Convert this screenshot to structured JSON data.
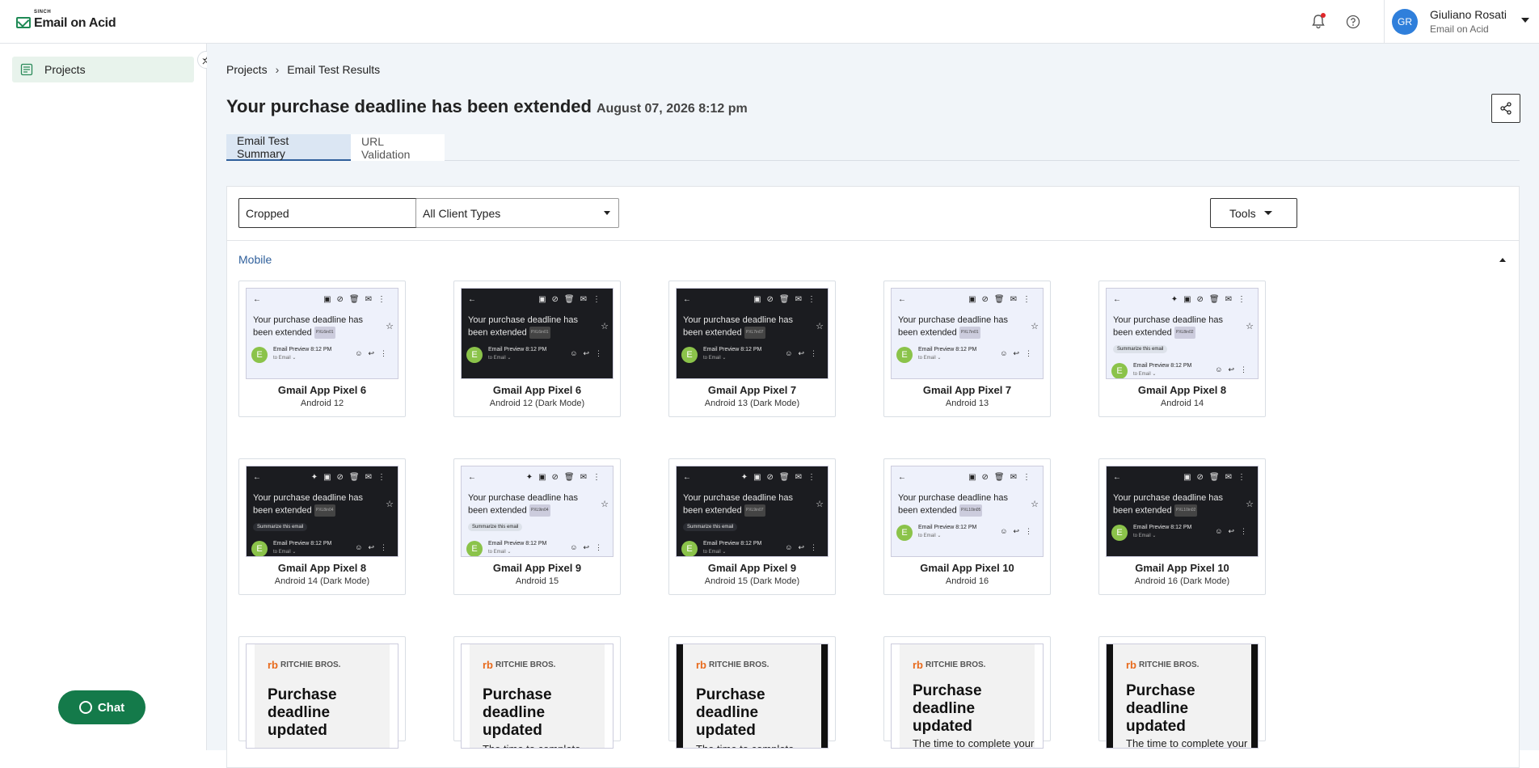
{
  "app": {
    "sinch": "SINCH",
    "brand": "Email on Acid"
  },
  "user": {
    "initials": "GR",
    "name": "Giuliano Rosati",
    "org": "Email on Acid"
  },
  "sidebar": {
    "items": [
      {
        "label": "Projects"
      }
    ]
  },
  "breadcrumb": {
    "parent": "Projects",
    "current": "Email Test Results"
  },
  "page": {
    "title": "Your purchase deadline has been extended",
    "date": "August 07, 2026 8:12 pm"
  },
  "tabs": [
    {
      "label": "Email Test Summary",
      "active": true
    },
    {
      "label": "URL Validation",
      "active": false
    }
  ],
  "filters": {
    "view": "Cropped",
    "client_types": "All Client Types",
    "tools": "Tools"
  },
  "section": {
    "label": "Mobile"
  },
  "gmail_preview": {
    "subject": "Your purchase deadline has been extended",
    "sender": "Email Preview",
    "time": "8:12 PM",
    "to": "to Email",
    "summarize": "Summarize this email"
  },
  "cards": [
    {
      "name": "Gmail App Pixel 6",
      "os": "Android 12",
      "mode": "light",
      "tag": "PXL6in01",
      "summarize": false
    },
    {
      "name": "Gmail App Pixel 6",
      "os": "Android 12 (Dark Mode)",
      "mode": "dark",
      "tag": "PXL6in01",
      "summarize": false
    },
    {
      "name": "Gmail App Pixel 7",
      "os": "Android 13 (Dark Mode)",
      "mode": "dark",
      "tag": "PXL7in07",
      "summarize": false
    },
    {
      "name": "Gmail App Pixel 7",
      "os": "Android 13",
      "mode": "light",
      "tag": "PXL7in01",
      "summarize": false
    },
    {
      "name": "Gmail App Pixel 8",
      "os": "Android 14",
      "mode": "light",
      "tag": "PXL8in02",
      "summarize": true
    },
    {
      "name": "Gmail App Pixel 8",
      "os": "Android 14 (Dark Mode)",
      "mode": "dark",
      "tag": "PXL8in04",
      "summarize": true
    },
    {
      "name": "Gmail App Pixel 9",
      "os": "Android 15",
      "mode": "light",
      "tag": "PXL9in04",
      "summarize": true
    },
    {
      "name": "Gmail App Pixel 9",
      "os": "Android 15 (Dark Mode)",
      "mode": "dark",
      "tag": "PXL9in07",
      "summarize": true
    },
    {
      "name": "Gmail App Pixel 10",
      "os": "Android 16",
      "mode": "light",
      "tag": "PXL10in05",
      "summarize": false
    },
    {
      "name": "Gmail App Pixel 10",
      "os": "Android 16 (Dark Mode)",
      "mode": "dark",
      "tag": "PXL10in02",
      "summarize": false
    }
  ],
  "promo": {
    "logo": "RITCHIE BROS.",
    "cards": [
      {
        "title": "Purchase deadline updated",
        "text": ""
      },
      {
        "title": "Purchase deadline updated",
        "text": "The time to complete"
      },
      {
        "title": "Purchase deadline updated",
        "text": "The time to complete"
      },
      {
        "title": "Purchase deadline updated",
        "text": "The time to complete your"
      },
      {
        "title": "Purchase deadline updated",
        "text": "The time to complete your"
      }
    ]
  },
  "chat": {
    "label": "Chat"
  },
  "colors": {
    "accent": "#2f5f9b",
    "brand_green": "#147a4a",
    "tab_active_bg": "#dbe6f3",
    "notification_dot": "#e0262a",
    "promo_orange": "#e86a1c"
  }
}
